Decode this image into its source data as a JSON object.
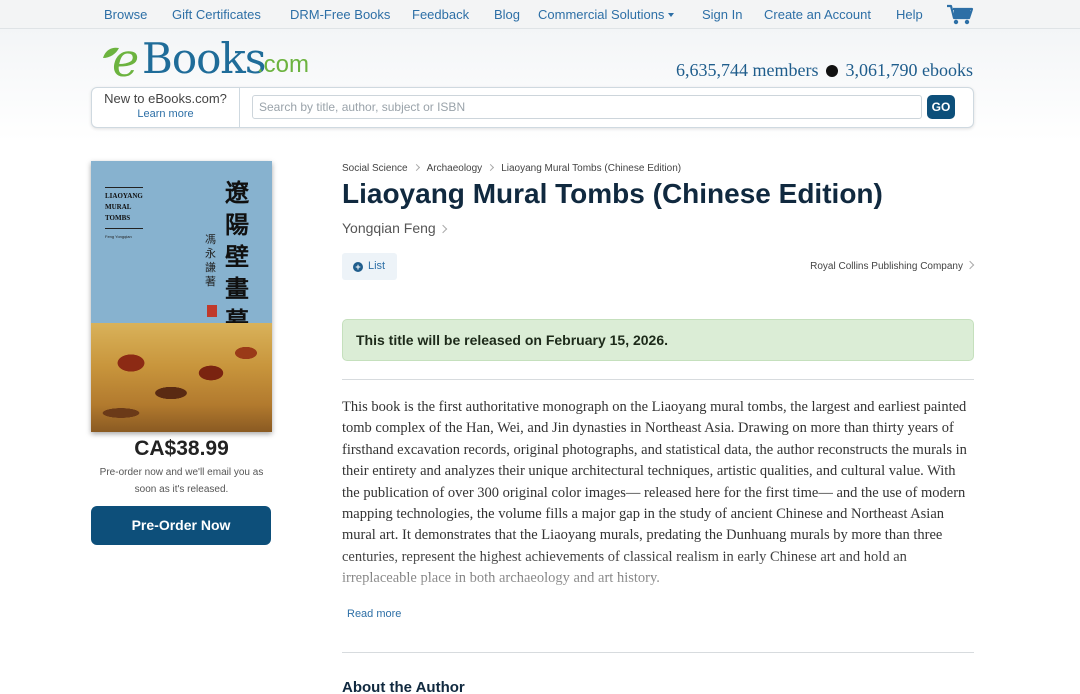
{
  "topnav": {
    "items": [
      "Browse",
      "Gift Certificates",
      "DRM-Free Books",
      "Feedback",
      "Blog",
      "Commercial Solutions",
      "Sign In",
      "Create an Account",
      "Help"
    ]
  },
  "header": {
    "logo": {
      "e": "e",
      "books": "Books",
      "com": ".com"
    },
    "members": "6,635,744 members",
    "ebooks": "3,061,790 ebooks"
  },
  "search": {
    "new_question": "New to eBooks.com?",
    "learn_more": "Learn more",
    "placeholder": "Search by title, author, subject or ISBN",
    "go_label": "GO"
  },
  "cover": {
    "title_lines": [
      "LIAOYANG",
      "MURAL",
      "TOMBS"
    ],
    "author_small": "Feng Yongqian",
    "cjk_title": "遼陽壁畫墓",
    "cjk_author": "馮永謙",
    "cjk_note": "著"
  },
  "purchase": {
    "price": "CA$38.99",
    "note_line1": "Pre-order now and we'll email you as",
    "note_line2": "soon as it's released.",
    "button": "Pre-Order Now"
  },
  "book": {
    "breadcrumbs": [
      "Social Science",
      "Archaeology",
      "Liaoyang Mural Tombs (Chinese Edition)"
    ],
    "title": "Liaoyang Mural Tombs (Chinese Edition)",
    "author": "Yongqian Feng",
    "list_label": "List",
    "publisher": "Royal Collins Publishing Company",
    "release_notice": "This title will be released on February 15, 2026.",
    "description": "This book is the first authoritative monograph on the Liaoyang mural tombs, the largest and earliest painted tomb complex of the Han, Wei, and Jin dynasties in Northeast Asia. Drawing on more than thirty years of firsthand excavation records, original photographs, and statistical data, the author reconstructs the murals in their entirety and analyzes their unique architectural techniques, artistic qualities, and cultural value. With the publication of over 300 original color images— released here for the first time— and the use of modern mapping technologies, the volume fills a major gap in the study of ancient Chinese and Northeast Asian mural art. It demonstrates that the Liaoyang murals, predating the Dunhuang murals by more than three centuries, represent the highest achievements of classical realism in early Chinese art and hold an irreplaceable place in both archaeology and art history.",
    "read_more": "Read more",
    "about_heading": "About the Author"
  },
  "colors": {
    "link": "#2d6fa6",
    "primary_button": "#0d4f7a",
    "notice_bg": "#dbedd6",
    "logo_green": "#6cb33f",
    "logo_blue": "#1f6c99"
  },
  "icons": [
    "cart-icon",
    "caret-down-icon",
    "plus-circle-icon",
    "chevron-right-icon",
    "leaf-icon"
  ]
}
